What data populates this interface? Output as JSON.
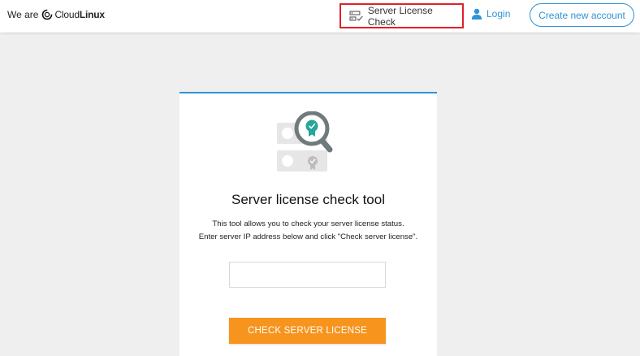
{
  "header": {
    "brand_prefix": "We are",
    "brand_cloud": "Cloud",
    "brand_linux": "Linux",
    "nav_license_check": "Server License Check",
    "nav_login": "Login",
    "create_account": "Create new account"
  },
  "card": {
    "title": "Server license check tool",
    "description_line1": "This tool allows you to check your server license status.",
    "description_line2": "Enter server IP address below and click \"Check server license\".",
    "ip_input_value": "",
    "ip_input_placeholder": "",
    "check_button": "CHECK SERVER LICENSE"
  },
  "colors": {
    "accent_blue": "#2f93d6",
    "button_orange": "#f7941d",
    "highlight_red": "#e0202a",
    "background": "#efefef"
  },
  "icons": [
    "cloudlinux-logo-icon",
    "server-check-icon",
    "user-icon",
    "server-license-magnifier-illustration"
  ]
}
